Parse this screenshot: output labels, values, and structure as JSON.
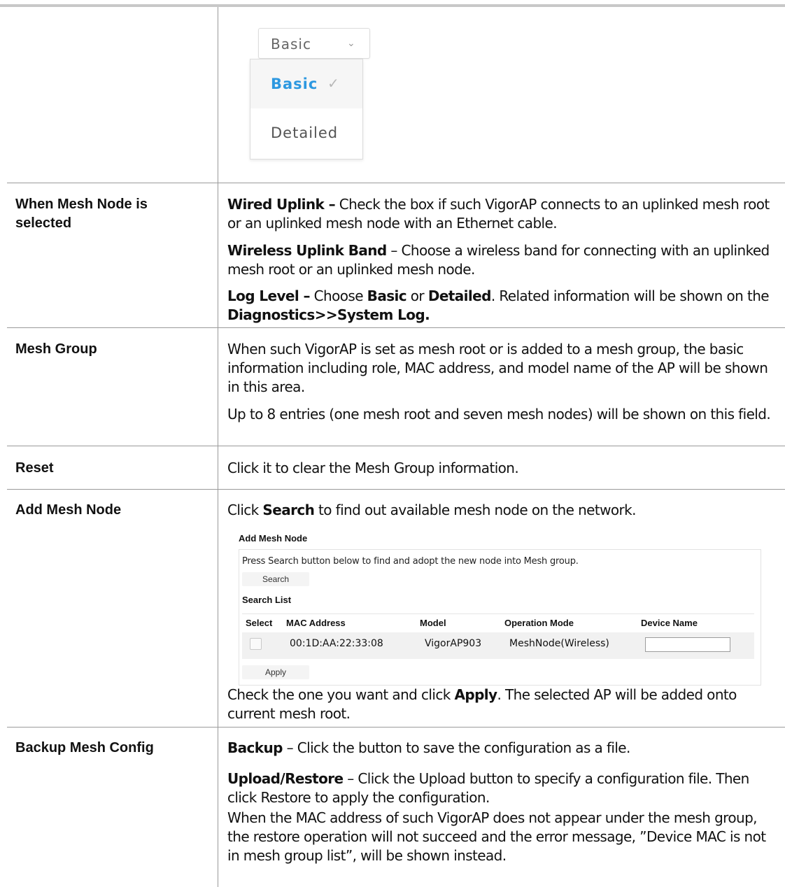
{
  "dropdown": {
    "selected_value": "Basic",
    "options": [
      {
        "label": "Basic",
        "selected": true
      },
      {
        "label": "Detailed",
        "selected": false
      }
    ],
    "accent_color": "#2d98e0"
  },
  "rows": {
    "mesh_node": {
      "label": "When Mesh Node is selected",
      "wired_uplink_term": "Wired Uplink –",
      "wired_uplink_text": " Check the box if such VigorAP connects to an uplinked mesh root or an uplinked mesh node with an Ethernet cable.",
      "wireless_band_term": "Wireless Uplink Band",
      "wireless_band_text": " – Choose a wireless band for connecting with an uplinked mesh root or an uplinked mesh node.",
      "log_level_term": "Log Level –",
      "log_level_text1": " Choose ",
      "log_level_basic": "Basic",
      "log_level_or": " or ",
      "log_level_detailed": "Detailed",
      "log_level_text2": ". Related information will be shown on the ",
      "log_level_path": "Diagnostics>>System Log."
    },
    "mesh_group": {
      "label": "Mesh Group",
      "para1": "When such VigorAP is set as mesh root or is added to a mesh group, the basic information including role, MAC address, and model name of the AP will be shown in this area.",
      "para2": "Up to 8 entries (one mesh root and seven mesh nodes) will be shown on this field."
    },
    "reset": {
      "label": "Reset",
      "text": "Click it to clear the Mesh Group information."
    },
    "add_mesh_node": {
      "label": "Add Mesh Node",
      "intro_pre": "Click ",
      "intro_term": "Search",
      "intro_post": " to find out available mesh node on the network.",
      "outro_pre": "Check the one you want and click ",
      "outro_term": "Apply",
      "outro_post": ". The selected AP will be added onto current mesh root."
    },
    "backup": {
      "label": "Backup Mesh Config",
      "backup_term": "Backup",
      "backup_text": " – Click the button to save the configuration as a file.",
      "upload_term": "Upload/Restore",
      "upload_text": " – Click the Upload button to specify a configuration file. Then click Restore to apply the configuration.",
      "mac_text": "When the MAC address of such VigorAP does not appear under the mesh group, the restore operation will not succeed and the error message, ”Device MAC is not in mesh group list”, will be shown instead."
    }
  },
  "panel": {
    "title": "Add Mesh Node",
    "instruction": "Press Search button below to find and adopt the new node into Mesh group.",
    "search_button": "Search",
    "list_title": "Search List",
    "columns": [
      "Select",
      "MAC Address",
      "Model",
      "Operation Mode",
      "Device Name"
    ],
    "rows": [
      {
        "mac": "00:1D:AA:22:33:08",
        "model": "VigorAP903",
        "mode": "MeshNode(Wireless)",
        "device_name": ""
      }
    ],
    "apply_button": "Apply"
  }
}
